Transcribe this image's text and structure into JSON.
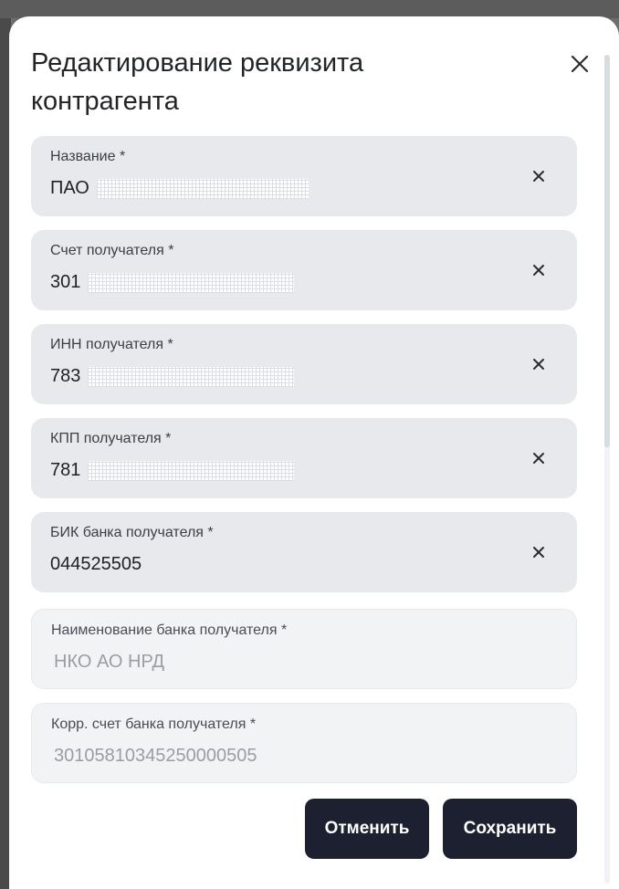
{
  "modal": {
    "title": "Редактирование реквизита\nконтрагента"
  },
  "fields": [
    {
      "label": "Название *",
      "value": "ПАО",
      "masked": true,
      "editable": true
    },
    {
      "label": "Счет получателя *",
      "value": "301",
      "masked": true,
      "editable": true
    },
    {
      "label": "ИНН получателя *",
      "value": "783",
      "masked": true,
      "editable": true
    },
    {
      "label": "КПП получателя *",
      "value": "781",
      "masked": true,
      "editable": true
    },
    {
      "label": "БИК банка получателя *",
      "value": "044525505",
      "masked": false,
      "editable": true
    },
    {
      "label": "Наименование банка получателя *",
      "value": "НКО АО НРД",
      "masked": false,
      "editable": false
    },
    {
      "label": "Корр. счет банка получателя *",
      "value": "30105810345250000505",
      "masked": false,
      "editable": false
    }
  ],
  "buttons": {
    "cancel_label": "Отменить",
    "save_label": "Сохранить"
  },
  "colors": {
    "button_bg": "#1d2030",
    "editable_field_bg": "#e7e9ed",
    "readonly_field_bg": "#f2f3f5"
  },
  "icons": {
    "close": "close-icon",
    "clear": "clear-icon"
  }
}
